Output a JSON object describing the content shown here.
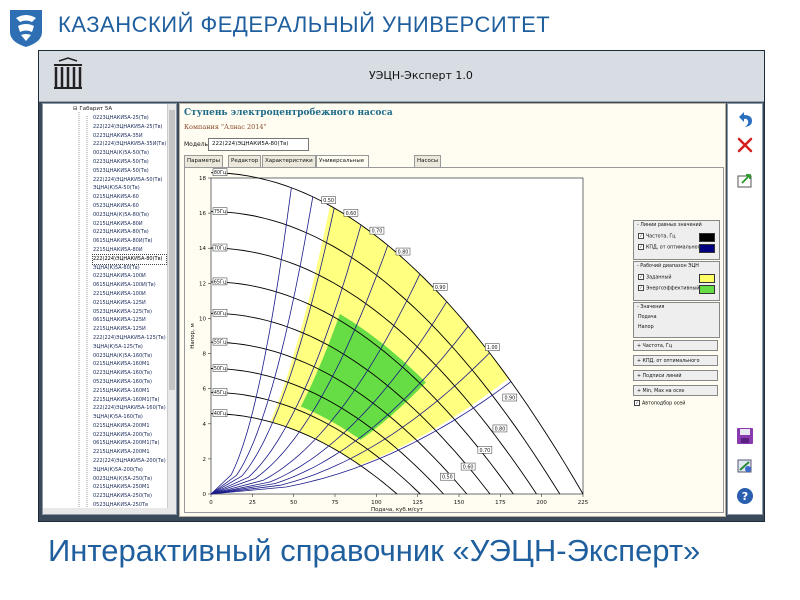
{
  "slide": {
    "header": "КАЗАНСКИЙ ФЕДЕРАЛЬНЫЙ УНИВЕРСИТЕТ",
    "caption": "Интерактивный справочник «УЭЦН-Эксперт»",
    "brand_color": "#1f5f9e"
  },
  "app": {
    "title": "УЭЦН-Эксперт 1.0",
    "tree": {
      "root": "Габарит 5А",
      "items": [
        "0223ЦНАКИ5А-25(Тв)",
        "222(224)ЭЦНАКИ5А-25(Тв)",
        "0223ЦНАКИ5А-35И",
        "222(224)ЭЦНАКИ5А-35И(Тв)",
        "0023ЦНА(К)5А-50(Тв)",
        "0223ЦНАКИ5А-50(Тв)",
        "0523ЦНАКИ5А-50(Тв)",
        "222(224)ЭЦНАКИ5А-50(Тв)",
        "ЭЦНА(К)5А-50(Тв)",
        "0215ЦНАКИ5А-60",
        "0523ЦНАКИ5А-60",
        "0023ЦНА(К)5А-80(Тв)",
        "0215ЦНАКИ5А-80И",
        "0223ЦНАКИ5А-80(Тв)",
        "0615ЦНАКИ5А-80И(Тв)",
        "2215ЦНАКИ5А-80И",
        "222(224)ЭЦНАКИ5А-80(Тв)",
        "ЭЦНА(К)5А-80(Тв)",
        "0223ЦНАКИ5А-100И",
        "0615ЦНАКИ5А-100И(Тв)",
        "2215ЦНАКИ5А-100И",
        "0215ЦНАКИ5А-125И",
        "0523ЦНАКИ5А-125(Тв)",
        "0615ЦНАКИ5А-125И",
        "2215ЦНАКИ5А-125И",
        "222(224)ЭЦНАКИ5А-125(Тв)",
        "ЭЦНА(К)5А-125(Тв)",
        "0023ЦНА(К)5А-160(Тв)",
        "0215ЦНАКИ5А-160М1",
        "0223ЦНАКИ5А-160(Тв)",
        "0523ЦНАКИ5А-160(Тв)",
        "2215ЦНАКИ5А-160М1",
        "2215ЦНАКИ5А-160М1(Тв)",
        "222(224)ЭЦНАКИ5А-160(Тв)",
        "ЭЦНА(К)5А-160(Тв)",
        "0215ЦНАКИ5А-200М1",
        "0223ЦНАКИ5А-200(Тв)",
        "0615ЦНАКИ5А-200М1(Тв)",
        "2215ЦНАКИ5А-200М1",
        "222(224)ЭЦНАКИ5А-200(Тв)",
        "ЭЦНА(К)5А-200(Тв)",
        "0023ЦНА(К)5А-250(Тв)",
        "0215ЦНАКИ5А-250М1",
        "0223ЦНАКИ5А-250(Тв)",
        "0523ЦНАКИ5А-250Тв",
        "0615ЦНАКИ5А-250М1(Тв)",
        "2215ЦНАКИ5А-250М1",
        "222(224)ЭЦНАКИ5А-250(Тв)",
        "ЭЦНА(К)5А-250(Тв)",
        "2123ЦНАКИ5А-280",
        "222(224)ЭЦНАКИ5А-320(Тв)",
        "0023ЦНА(К)5А-400"
      ],
      "selected_index": 16
    },
    "panel": {
      "title": "Ступень электроцентробежного насоса",
      "company": "Компания \"Алнас 2014\"",
      "model_label": "Модель",
      "model_value": "222(224)ЭЦНАКИ5А-80(Тв)",
      "tabs": [
        "Параметры",
        "Редактор",
        "Характеристики",
        "Универсальные характеристики",
        "Насосы"
      ],
      "active_tab": 3
    },
    "side": {
      "equal_lines": "Линии равных значений",
      "freq": "Частота, Гц",
      "kpd": "КПД, от оптимального",
      "work_range": "Рабочий диапазон ЭЦН",
      "given": "Заданный",
      "energy": "Энергоэффективный",
      "values": "Значения",
      "feed": "Подача",
      "head": "Напор",
      "btn_freq": "Частота, Гц",
      "btn_kpd": "КПД, от оптимального",
      "btn_labels": "Подписи линий",
      "btn_minmax": "Min, Max на осях",
      "autoselect": "Автоподбор осей",
      "color_freq": "#000000",
      "color_kpd": "#000080",
      "color_given": "#ffff66",
      "color_energy": "#66dd44"
    },
    "toolbar": {
      "undo_icon": "undo-arrow-icon",
      "delete_icon": "red-x-icon",
      "export_icon": "export-icon",
      "save_icon": "floppy-disk-icon",
      "tools_icon": "tools-icon",
      "help_icon": "help-icon"
    }
  },
  "chart_data": {
    "type": "line",
    "xlabel": "Подача, куб.м/сут",
    "ylabel": "Напор, м",
    "xlim": [
      0,
      225
    ],
    "ylim": [
      0,
      18
    ],
    "xticks": [
      0,
      25,
      50,
      75,
      100,
      125,
      150,
      175,
      200,
      225
    ],
    "yticks": [
      0,
      2,
      4,
      6,
      8,
      10,
      12,
      14,
      16,
      18
    ],
    "freq_labels": [
      "80Гц",
      "75Гц",
      "70Гц",
      "65Гц",
      "60Гц",
      "55Гц",
      "50Гц",
      "45Гц",
      "40Гц"
    ],
    "freqs": [
      80,
      75,
      70,
      65,
      60,
      55,
      50,
      45,
      40
    ],
    "kpd_labels_top": [
      "0.50",
      "0.60",
      "0.70",
      "0.80",
      "0.90",
      "1.00"
    ],
    "kpd_labels_side": [
      "0.90",
      "0.80",
      "0.70",
      "0.60",
      "0.50"
    ],
    "curve_base": {
      "h0": 18.3,
      "q_end": 225
    },
    "colors": {
      "given": "#ffff80",
      "energy": "#66dd44",
      "freq_line": "#000000",
      "kpd_line": "#1a1a8a"
    }
  }
}
